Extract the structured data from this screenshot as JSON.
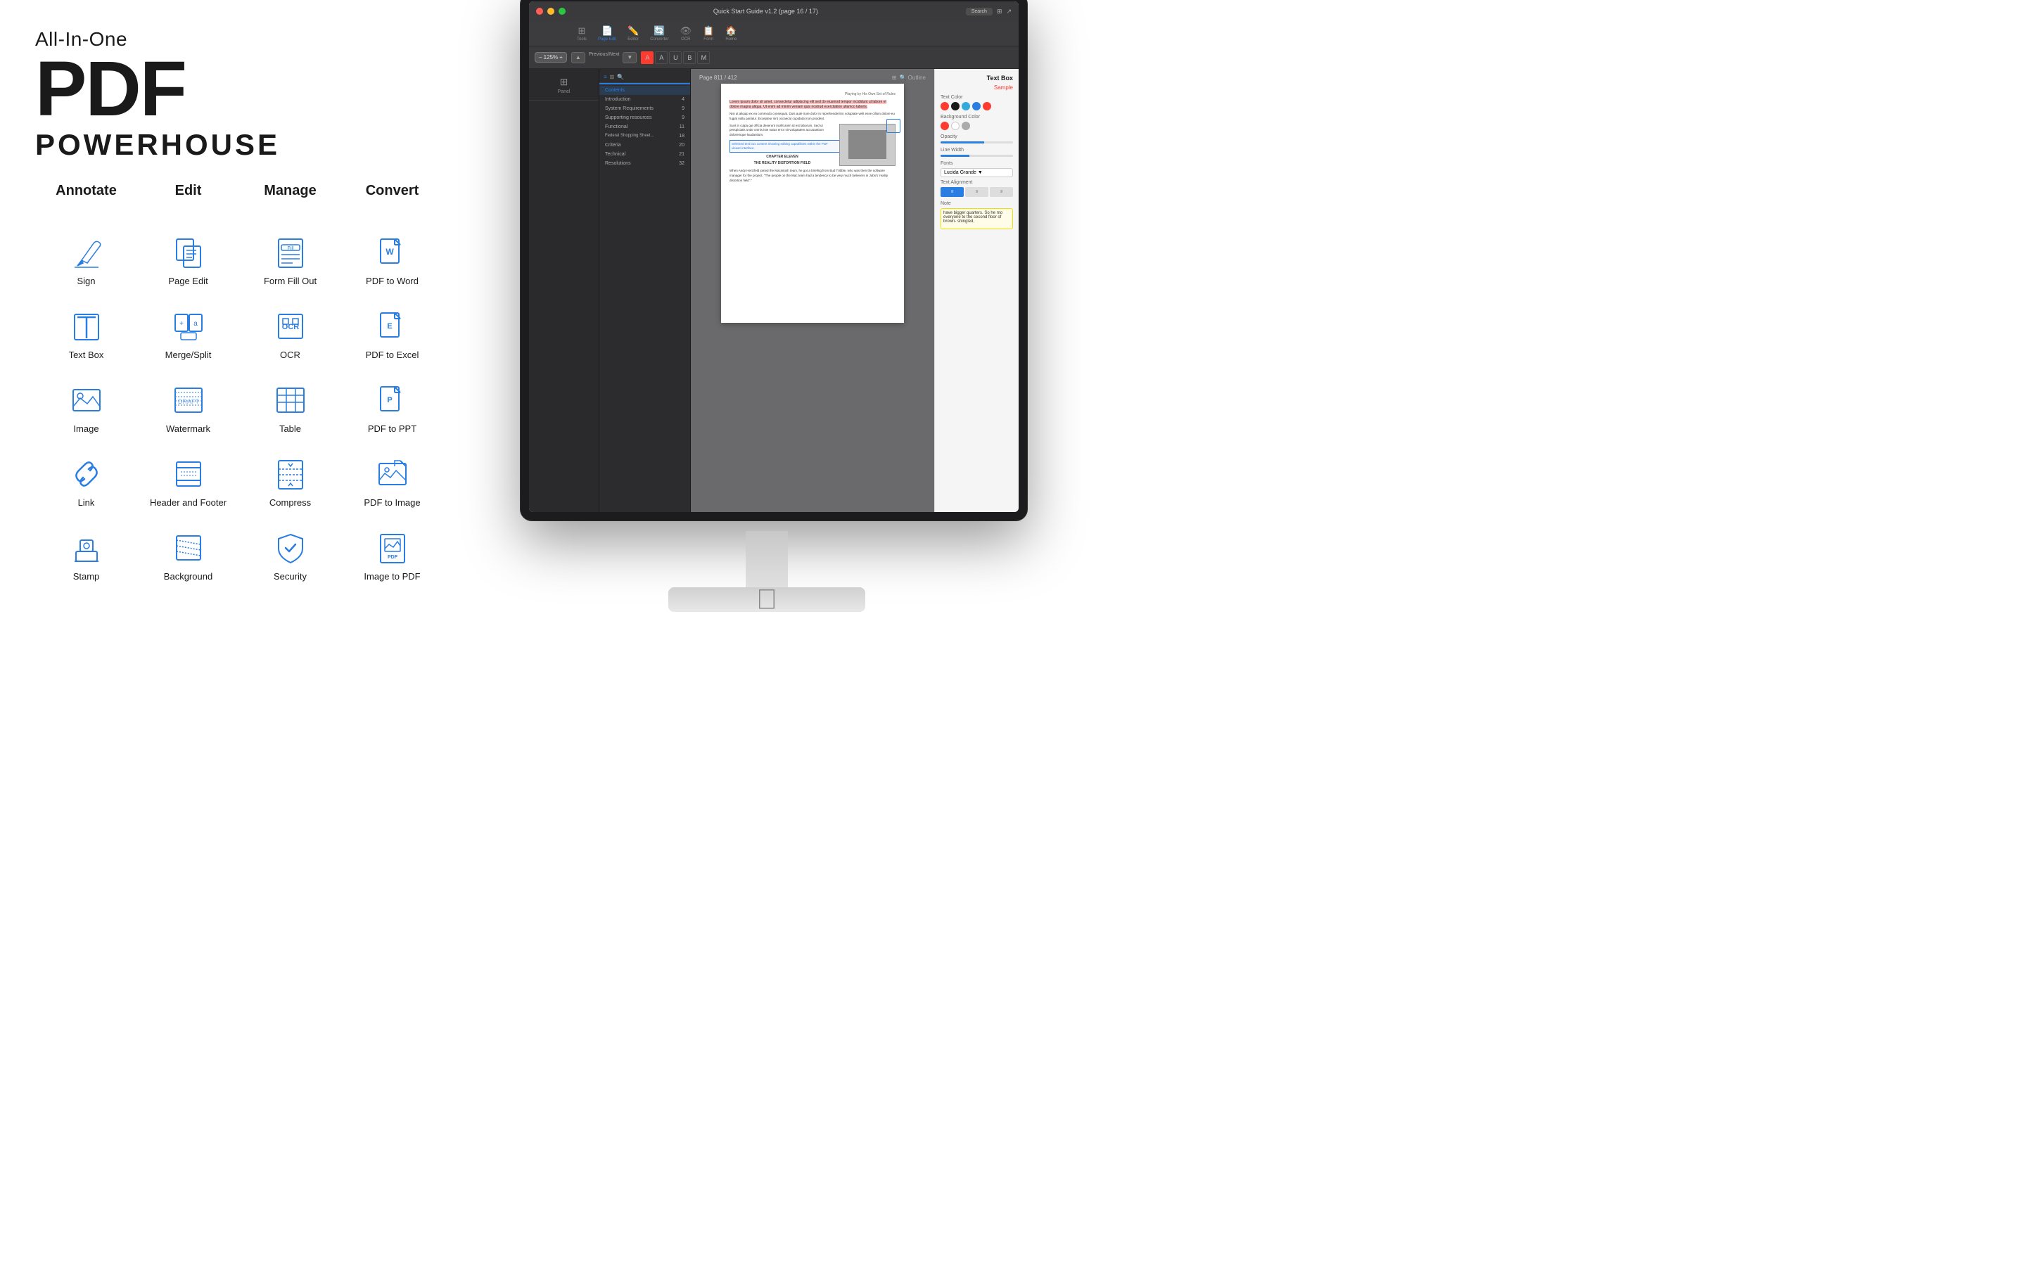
{
  "headline": {
    "small": "All-In-One",
    "pdf": "PDF",
    "powerhouse": "POWERHOUSE"
  },
  "categories": [
    {
      "id": "annotate",
      "label": "Annotate"
    },
    {
      "id": "edit",
      "label": "Edit"
    },
    {
      "id": "manage",
      "label": "Manage"
    },
    {
      "id": "convert",
      "label": "Convert"
    }
  ],
  "icons": [
    {
      "id": "sign",
      "label": "Sign",
      "col": 1,
      "row": 1
    },
    {
      "id": "page-edit",
      "label": "Page Edit",
      "col": 2,
      "row": 1
    },
    {
      "id": "form-fill-out",
      "label": "Form Fill Out",
      "col": 3,
      "row": 1
    },
    {
      "id": "pdf-to-word",
      "label": "PDF to Word",
      "col": 4,
      "row": 1
    },
    {
      "id": "text-box",
      "label": "Text Box",
      "col": 1,
      "row": 2
    },
    {
      "id": "merge-split",
      "label": "Merge/Split",
      "col": 2,
      "row": 2
    },
    {
      "id": "ocr",
      "label": "OCR",
      "col": 3,
      "row": 2
    },
    {
      "id": "pdf-to-excel",
      "label": "PDF to Excel",
      "col": 4,
      "row": 2
    },
    {
      "id": "image",
      "label": "Image",
      "col": 1,
      "row": 3
    },
    {
      "id": "watermark",
      "label": "Watermark",
      "col": 2,
      "row": 3
    },
    {
      "id": "table",
      "label": "Table",
      "col": 3,
      "row": 3
    },
    {
      "id": "pdf-to-ppt",
      "label": "PDF to PPT",
      "col": 4,
      "row": 3
    },
    {
      "id": "link",
      "label": "Link",
      "col": 1,
      "row": 4
    },
    {
      "id": "header-footer",
      "label": "Header and Footer",
      "col": 2,
      "row": 4
    },
    {
      "id": "compress",
      "label": "Compress",
      "col": 3,
      "row": 4
    },
    {
      "id": "pdf-to-image",
      "label": "PDF to Image",
      "col": 4,
      "row": 4
    },
    {
      "id": "stamp",
      "label": "Stamp",
      "col": 1,
      "row": 5
    },
    {
      "id": "background",
      "label": "Background",
      "col": 2,
      "row": 5
    },
    {
      "id": "security",
      "label": "Security",
      "col": 3,
      "row": 5
    },
    {
      "id": "image-to-pdf",
      "label": "Image to PDF",
      "col": 4,
      "row": 5
    }
  ],
  "app": {
    "title": "Quick Start Guide v1.2 (page 16 / 17)",
    "zoom": "125%",
    "page_info": "Page 811 / 412",
    "search_placeholder": "Search",
    "right_panel_title": "Text Box",
    "sample_label": "Sample",
    "text_color_label": "Text Color",
    "bg_color_label": "Background Color",
    "opacity_label": "Opacity",
    "line_width_label": "Line Width",
    "fonts_label": "Fonts",
    "font_name": "Lucida Grande",
    "text_align_label": "Text Alignment",
    "note_label": "Note",
    "note_text": "have bigger quarters. So he mo everyone to the second floor of brown- shingled,"
  },
  "tabs": [
    {
      "id": "tools",
      "label": "Tools"
    },
    {
      "id": "page-edit",
      "label": "Page Edit"
    },
    {
      "id": "editor",
      "label": "Editor"
    },
    {
      "id": "converter",
      "label": "Converter"
    },
    {
      "id": "ocr",
      "label": "OCR"
    },
    {
      "id": "form",
      "label": "Form"
    },
    {
      "id": "home",
      "label": "Home"
    }
  ],
  "toc_items": [
    {
      "label": "Contents",
      "page": ""
    },
    {
      "label": "Introduction",
      "page": "4"
    },
    {
      "label": "System Requirements",
      "page": "9"
    },
    {
      "label": "Supporting resources",
      "page": "9"
    },
    {
      "label": "Functional",
      "page": "11"
    },
    {
      "label": "Federal Shopping Sheet Updates...",
      "page": "18"
    },
    {
      "label": "Criteria",
      "page": "20"
    },
    {
      "label": "Technical",
      "page": "21"
    },
    {
      "label": "Resolutions",
      "page": "32"
    }
  ],
  "colors": {
    "accent": "#2a7de1",
    "red": "#ff3b30",
    "dark": "#1a1a1a"
  }
}
